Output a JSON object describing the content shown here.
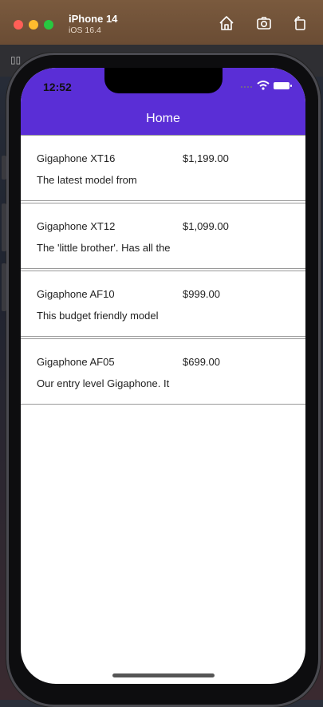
{
  "simulator": {
    "device_name": "iPhone 14",
    "os_version": "iOS 16.4",
    "icons": [
      "home-icon",
      "screenshot-icon",
      "rotate-icon"
    ]
  },
  "status_bar": {
    "time": "12:52"
  },
  "nav": {
    "title": "Home",
    "accent_color": "#5a2ed6"
  },
  "products": [
    {
      "name": "Gigaphone XT16",
      "price": "$1,199.00",
      "description": "The latest model from"
    },
    {
      "name": "Gigaphone XT12",
      "price": "$1,099.00",
      "description": "The 'little brother'. Has all the"
    },
    {
      "name": "Gigaphone AF10",
      "price": "$999.00",
      "description": "This budget friendly model"
    },
    {
      "name": "Gigaphone AF05",
      "price": "$699.00",
      "description": "Our entry level Gigaphone. It"
    }
  ]
}
